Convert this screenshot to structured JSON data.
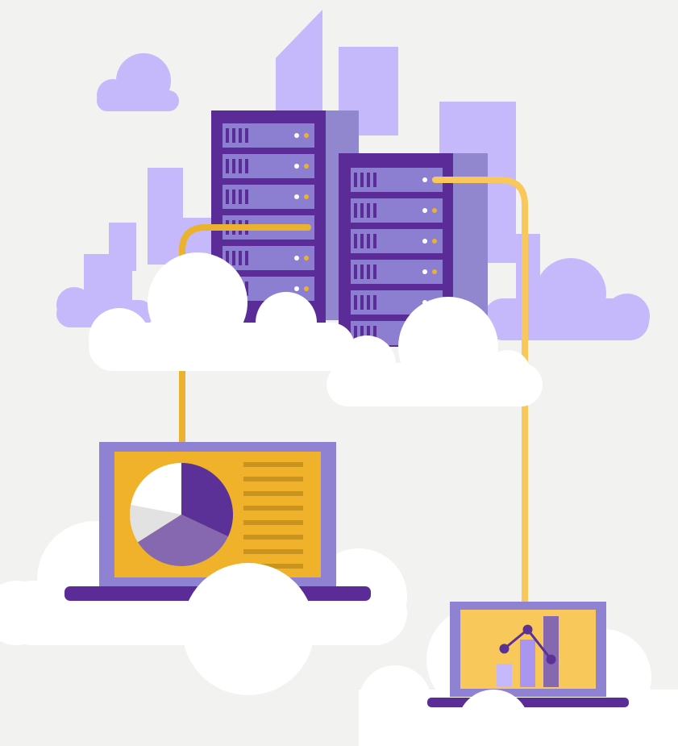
{
  "illustration": {
    "subject": "cloud-computing",
    "colors": {
      "background": "#f2f2f1",
      "city_light": "#c5b9fb",
      "server_dark": "#5b2c98",
      "server_mid": "#8c7fd1",
      "server_panel": "#9187cf",
      "connector": "#ebb22e",
      "connector_light": "#f9c85a",
      "screen_yellow": "#efb22a",
      "laptop_frame": "#8f82d3",
      "cloud": "#ffffff",
      "pie_dark": "#5b3197",
      "pie_mid": "#8668b1",
      "pie_light": "#e2e2e2",
      "text_lines": "#c9931f"
    },
    "icons": [
      "city-skyline-icon",
      "server-rack-icon",
      "laptop-pie-chart-icon",
      "tablet-bar-chart-icon",
      "cloud-icon"
    ],
    "pie_chart": {
      "slices": [
        0.32,
        0.34,
        0.12,
        0.22
      ]
    },
    "bar_chart": {
      "values": [
        0.33,
        0.67,
        1.0
      ],
      "trend": [
        0.45,
        0.72,
        0.3
      ]
    }
  }
}
